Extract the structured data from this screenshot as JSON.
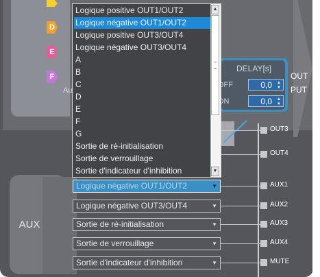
{
  "tags": {
    "c": "",
    "d": "D",
    "e": "E",
    "f": "F"
  },
  "fragments": {
    "au": "Au"
  },
  "delay": {
    "title": "DELAY[s]",
    "off_label": "OFF",
    "on_label": "ON",
    "off_value": "0,0",
    "on_value": "0,0"
  },
  "output_label": {
    "line1": "OUT",
    "line2": "PUT"
  },
  "terminals": [
    "OUT3",
    "OUT4",
    "AUX1",
    "AUX2",
    "AUX3",
    "AUX4",
    "MUTE"
  ],
  "aux_label": "AUX",
  "dropdown_options": [
    "Logique positive OUT1/OUT2",
    "Logique négative OUT1/OUT2",
    "Logique positive OUT3/OUT4",
    "Logique négative OUT3/OUT4",
    "A",
    "B",
    "C",
    "D",
    "E",
    "F",
    "G",
    "Sortie de ré-initialisation",
    "Sortie de verrouillage",
    "Sortie d'indicateur d'inhibition"
  ],
  "dropdown_selected_index": 1,
  "selects": {
    "aux1": "Logique négative OUT1/OUT2",
    "aux2": "Logique négative OUT3/OUT4",
    "aux3": "Sortie de ré-initialisation",
    "aux4": "Sortie de verrouillage",
    "mute": "Sortie d'indicateur d'inhibition"
  },
  "colors": {
    "accent_blue": "#3a8fc4",
    "selection_blue": "#1d8ad8",
    "tag_d": "#f1a22b",
    "tag_e": "#e45e9d",
    "tag_f": "#c277d9"
  }
}
